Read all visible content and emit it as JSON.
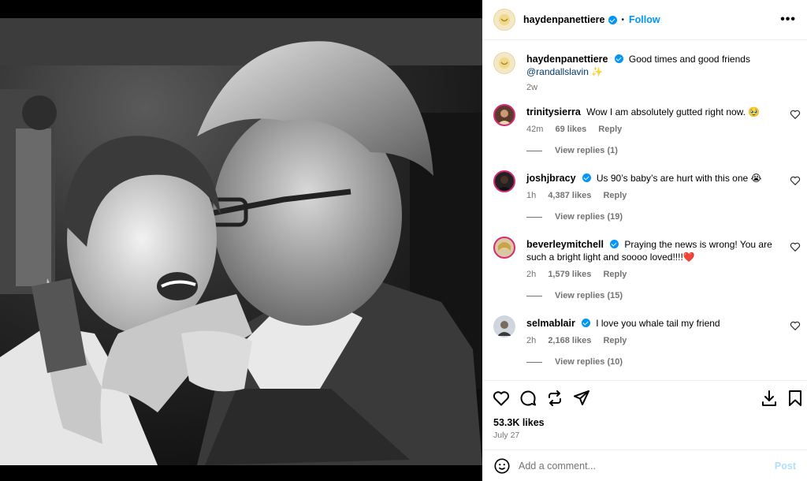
{
  "header": {
    "username": "haydenpanettiere",
    "follow_label": "Follow",
    "more_label": "•••",
    "dot": "•"
  },
  "caption": {
    "username": "haydenpanettiere",
    "text": "Good times and good friends",
    "mention": "@randallslavin",
    "sparkle": "✨",
    "time": "2w"
  },
  "comments": [
    {
      "username": "trinitysierra",
      "verified": false,
      "text": "Wow I am absolutely gutted right now. 🥹",
      "time": "42m",
      "likes": "69 likes",
      "reply_label": "Reply",
      "view_replies": "View replies (1)"
    },
    {
      "username": "joshjbracy",
      "verified": true,
      "text": "Us 90’s baby’s are hurt with this one 😭",
      "time": "1h",
      "likes": "4,387 likes",
      "reply_label": "Reply",
      "view_replies": "View replies (19)"
    },
    {
      "username": "beverleymitchell",
      "verified": true,
      "text": "Praying the news is wrong! You are such a bright light and soooo loved!!!!❤️",
      "time": "2h",
      "likes": "1,579 likes",
      "reply_label": "Reply",
      "view_replies": "View replies (15)"
    },
    {
      "username": "selmablair",
      "verified": true,
      "text": "I love you whale tail my friend",
      "time": "2h",
      "likes": "2,168 likes",
      "reply_label": "Reply",
      "view_replies": "View replies (10)"
    }
  ],
  "post_stats": {
    "likes": "53.3K likes",
    "date": "July 27"
  },
  "add_comment": {
    "placeholder": "Add a comment...",
    "post_label": "Post"
  },
  "colors": {
    "accent": "#0095f6",
    "muted": "#737373",
    "post_disabled": "#b2dffc"
  },
  "icons": [
    "like-icon",
    "comment-icon",
    "share-icon",
    "send-icon",
    "download-icon",
    "save-icon",
    "emoji-icon",
    "heart-icon",
    "verified-icon"
  ]
}
